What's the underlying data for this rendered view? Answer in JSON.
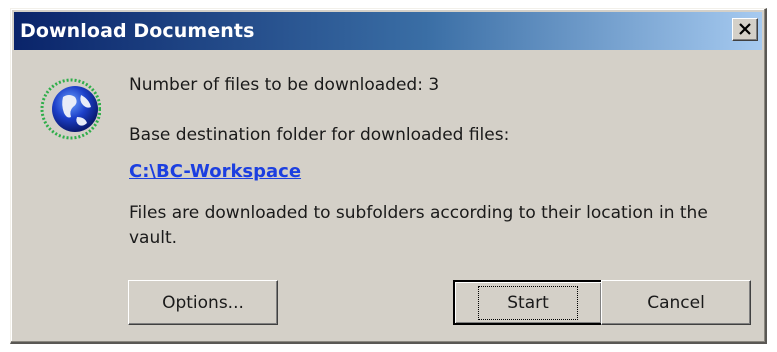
{
  "window": {
    "title": "Download Documents",
    "close_icon": "close-icon"
  },
  "icon": {
    "name": "globe-icon"
  },
  "content": {
    "file_count_text": "Number of files to be downloaded: 3",
    "destination_label": "Base destination folder for downloaded files:",
    "destination_path": "C:\\BC-Workspace",
    "info_text": "Files are downloaded to subfolders according to their location in the vault."
  },
  "buttons": {
    "options_label": "Options...",
    "start_label": "Start",
    "cancel_label": "Cancel"
  },
  "colors": {
    "title_bar_start": "#0a246a",
    "title_bar_end": "#a6caf0",
    "dialog_bg": "#d4d0c8",
    "link": "#1c3fe0"
  }
}
